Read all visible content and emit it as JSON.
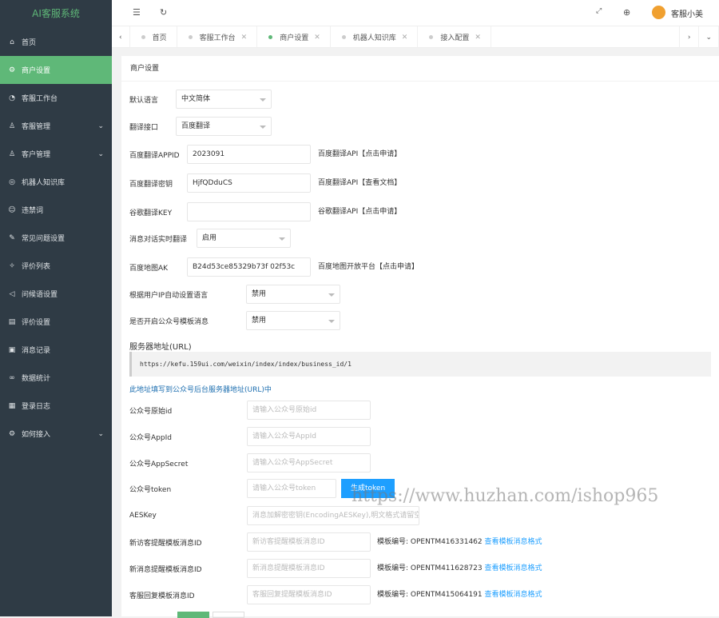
{
  "app_title": "AI客服系统",
  "sidebar": [
    {
      "label": "首页",
      "icon": "home-icon",
      "glyph": "⌂"
    },
    {
      "label": "商户设置",
      "icon": "settings-icon",
      "glyph": "⚙",
      "active": true
    },
    {
      "label": "客服工作台",
      "icon": "workbench-icon",
      "glyph": "◔"
    },
    {
      "label": "客服管理",
      "icon": "user-icon",
      "glyph": "♙",
      "chevron": true
    },
    {
      "label": "客户管理",
      "icon": "users-icon",
      "glyph": "♙",
      "chevron": true
    },
    {
      "label": "机器人知识库",
      "icon": "robot-icon",
      "glyph": "◎"
    },
    {
      "label": "违禁词",
      "icon": "forbidden-icon",
      "glyph": "☺"
    },
    {
      "label": "常见问题设置",
      "icon": "faq-icon",
      "glyph": "✎"
    },
    {
      "label": "评价列表",
      "icon": "list-icon",
      "glyph": "✧"
    },
    {
      "label": "问候语设置",
      "icon": "greeting-icon",
      "glyph": "◁"
    },
    {
      "label": "评价设置",
      "icon": "rating-icon",
      "glyph": "▤"
    },
    {
      "label": "消息记录",
      "icon": "message-icon",
      "glyph": "▣"
    },
    {
      "label": "数据统计",
      "icon": "stats-icon",
      "glyph": "∞"
    },
    {
      "label": "登录日志",
      "icon": "log-icon",
      "glyph": "▦"
    },
    {
      "label": "如何接入",
      "icon": "access-icon",
      "glyph": "⚙",
      "chevron": true
    }
  ],
  "topbar": {
    "user": "客服小美"
  },
  "tabs": [
    {
      "label": "首页",
      "closable": false
    },
    {
      "label": "客服工作台",
      "closable": true
    },
    {
      "label": "商户设置",
      "closable": true,
      "active": true
    },
    {
      "label": "机器人知识库",
      "closable": true
    },
    {
      "label": "接入配置",
      "closable": true
    }
  ],
  "breadcrumb": "商户设置",
  "form": {
    "default_language": {
      "label": "默认语言",
      "value": "中文简体"
    },
    "translate_api": {
      "label": "翻译接口",
      "value": "百度翻译"
    },
    "baidu_appid": {
      "label": "百度翻译APPID",
      "value": "2023091",
      "hint": "百度翻译API【点击申请】"
    },
    "baidu_key": {
      "label": "百度翻译密钥",
      "value": "HjfQDduCS",
      "hint": "百度翻译API【查看文档】"
    },
    "google_key": {
      "label": "谷歌翻译KEY",
      "value": "",
      "hint": "谷歌翻译API【点击申请】"
    },
    "realtime_translate": {
      "label": "消息对话实时翻译",
      "value": "启用"
    },
    "baidu_map_ak": {
      "label": "百度地图AK",
      "value": "B24d53ce85329b73f            02f53c",
      "hint": "百度地图开放平台【点击申请】"
    },
    "ip_language": {
      "label": "根据用户IP自动设置语言",
      "value": "禁用"
    },
    "mp_template": {
      "label": "是否开启公众号模板消息",
      "value": "禁用"
    },
    "server_url_title": "服务器地址(URL)",
    "server_url": "https://kefu.159ui.com/weixin/index/index/business_id/1",
    "server_url_note": "此地址填写到公众号后台服务器地址(URL)中",
    "mp_origin_id": {
      "label": "公众号原始id",
      "placeholder": "请输入公众号原始id"
    },
    "mp_appid": {
      "label": "公众号AppId",
      "placeholder": "请输入公众号AppId"
    },
    "mp_secret": {
      "label": "公众号AppSecret",
      "placeholder": "请输入公众号AppSecret"
    },
    "mp_token": {
      "label": "公众号token",
      "placeholder": "请输入公众号token",
      "button": "生成token"
    },
    "aeskey": {
      "label": "AESKey",
      "placeholder": "消息加解密密钥(EncodingAESKey),明文格式请留空"
    },
    "tpl_visitor": {
      "label": "新访客提醒模板消息ID",
      "placeholder": "新访客提醒模板消息ID",
      "hint": "模板编号: OPENTM416331462",
      "link": "查看模板消息格式"
    },
    "tpl_message": {
      "label": "新消息提醒模板消息ID",
      "placeholder": "新消息提醒模板消息ID",
      "hint": "模板编号: OPENTM411628723",
      "link": "查看模板消息格式"
    },
    "tpl_reply": {
      "label": "客服回复模板消息ID",
      "placeholder": "客服回复提醒模板消息ID",
      "hint": "模板编号: OPENTM415064191",
      "link": "查看模板消息格式"
    }
  },
  "watermark": "https://www.huzhan.com/ishop965",
  "colors": {
    "accent": "#5fb878",
    "sidebar": "#2f3b45",
    "button": "#1e9fff"
  }
}
